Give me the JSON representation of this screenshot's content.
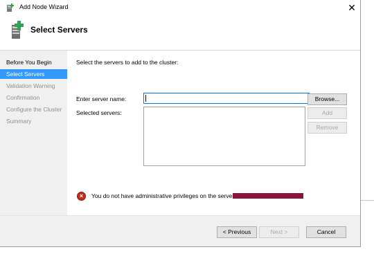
{
  "window": {
    "title": "Add Node Wizard",
    "close_glyph": "✕"
  },
  "header": {
    "title": "Select Servers",
    "icon": "server-add-icon"
  },
  "nav": {
    "items": [
      {
        "label": "Before You Begin",
        "state": "normal"
      },
      {
        "label": "Select Servers",
        "state": "active"
      },
      {
        "label": "Validation Warning",
        "state": "disabled"
      },
      {
        "label": "Confirmation",
        "state": "disabled"
      },
      {
        "label": "Configure the Cluster",
        "state": "disabled"
      },
      {
        "label": "Summary",
        "state": "disabled"
      }
    ]
  },
  "main": {
    "instruction": "Select the servers to add to the cluster:",
    "server_name_label": "Enter server name:",
    "server_name_value": "",
    "selected_servers_label": "Selected servers:",
    "browse_label": "Browse...",
    "add_label": "Add",
    "remove_label": "Remove",
    "error_message": "You do not have administrative privileges on the server '"
  },
  "footer": {
    "previous_label": "< Previous",
    "next_label": "Next >",
    "cancel_label": "Cancel"
  },
  "colors": {
    "selection": "#3399ff",
    "error": "#c42b1c",
    "redaction": "#8b1538",
    "input_focus_border": "#0078d7"
  }
}
